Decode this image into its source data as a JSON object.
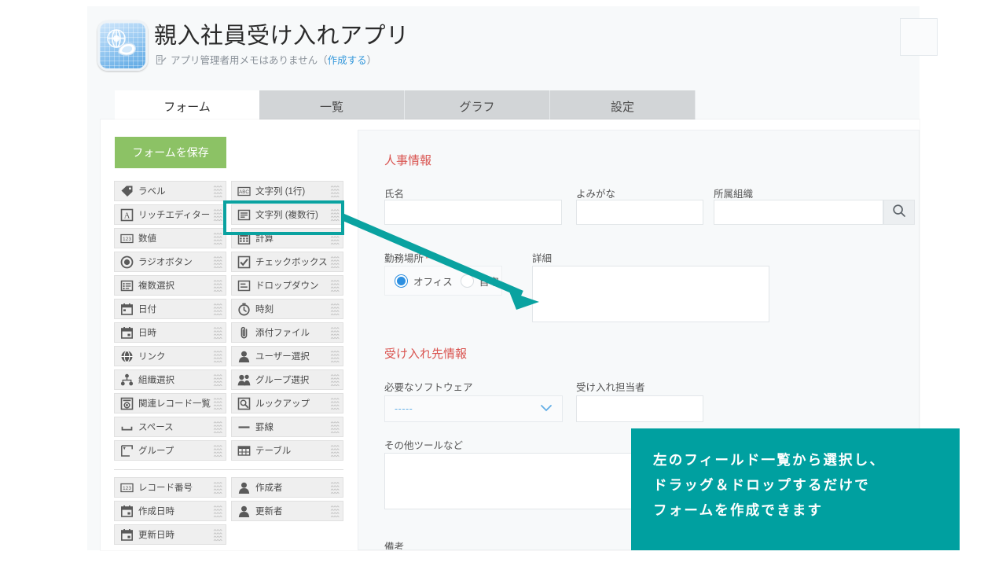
{
  "header": {
    "app_title": "親入社員受け入れアプリ",
    "memo_text": "アプリ管理者用メモはありません",
    "memo_link_open": "（",
    "memo_link": "作成する",
    "memo_link_close": "）",
    "memo_icon": "note-edit-icon",
    "app_icon": "app-globe-icon"
  },
  "tabs": [
    {
      "label": "フォーム",
      "active": true
    },
    {
      "label": "一覧",
      "active": false
    },
    {
      "label": "グラフ",
      "active": false
    },
    {
      "label": "設定",
      "active": false
    }
  ],
  "toolbar": {
    "save_label": "フォームを保存"
  },
  "palette": {
    "group1": [
      {
        "label": "ラベル",
        "icon": "tag-icon"
      },
      {
        "label": "文字列 (1行)",
        "icon": "abc-icon"
      },
      {
        "label": "リッチエディター",
        "icon": "rich-text-icon"
      },
      {
        "label": "文字列 (複数行)",
        "icon": "multiline-text-icon",
        "highlighted": true
      },
      {
        "label": "数値",
        "icon": "number-123-icon"
      },
      {
        "label": "計算",
        "icon": "calculator-icon"
      },
      {
        "label": "ラジオボタン",
        "icon": "radio-button-icon"
      },
      {
        "label": "チェックボックス",
        "icon": "checkbox-icon"
      },
      {
        "label": "複数選択",
        "icon": "multi-select-icon"
      },
      {
        "label": "ドロップダウン",
        "icon": "dropdown-icon"
      },
      {
        "label": "日付",
        "icon": "calendar-icon"
      },
      {
        "label": "時刻",
        "icon": "clock-icon"
      },
      {
        "label": "日時",
        "icon": "calendar-time-icon"
      },
      {
        "label": "添付ファイル",
        "icon": "paperclip-icon"
      },
      {
        "label": "リンク",
        "icon": "globe-link-icon"
      },
      {
        "label": "ユーザー選択",
        "icon": "user-icon"
      },
      {
        "label": "組織選択",
        "icon": "org-tree-icon"
      },
      {
        "label": "グループ選択",
        "icon": "group-users-icon"
      },
      {
        "label": "関連レコード一覧",
        "icon": "related-records-icon"
      },
      {
        "label": "ルックアップ",
        "icon": "lookup-search-icon"
      },
      {
        "label": "スペース",
        "icon": "space-icon"
      },
      {
        "label": "罫線",
        "icon": "horizontal-rule-icon"
      },
      {
        "label": "グループ",
        "icon": "group-box-icon"
      },
      {
        "label": "テーブル",
        "icon": "table-icon"
      }
    ],
    "group2": [
      {
        "label": "レコード番号",
        "icon": "number-123-icon"
      },
      {
        "label": "作成者",
        "icon": "user-icon"
      },
      {
        "label": "作成日時",
        "icon": "calendar-time-icon"
      },
      {
        "label": "更新者",
        "icon": "user-icon"
      },
      {
        "label": "更新日時",
        "icon": "calendar-time-icon"
      }
    ]
  },
  "form": {
    "section1_title": "人事情報",
    "section2_title": "受け入れ先情報",
    "fields": {
      "name_label": "氏名",
      "name_value": "",
      "kana_label": "よみがな",
      "kana_value": "",
      "org_label": "所属組織",
      "org_value": "",
      "org_search_icon": "search-icon",
      "workplace_label": "勤務場所",
      "workplace_required": "*",
      "workplace_options": [
        "オフィス",
        "自宅"
      ],
      "workplace_selected": "オフィス",
      "detail_label": "詳細",
      "detail_value": "",
      "software_label": "必要なソフトウェア",
      "software_value": "-----",
      "software_chevron": "chevron-down-icon",
      "owner_label": "受け入れ担当者",
      "owner_value": "",
      "other_tools_label": "その他ツールなど",
      "other_tools_value": "",
      "remarks_label": "備考"
    }
  },
  "callout": {
    "lines": [
      "左のフィールド一覧から選択し、",
      "ドラッグ＆ドロップするだけで",
      "フォームを作成できます"
    ]
  },
  "annotation": {
    "arrow_icon": "arrow-pointer",
    "highlight_target": "文字列 (複数行)"
  },
  "colors": {
    "teal": "#00a0a0",
    "save_green": "#8cc265",
    "section_red": "#d9534f",
    "link_blue": "#3498db",
    "radio_blue": "#2d8fe0"
  }
}
